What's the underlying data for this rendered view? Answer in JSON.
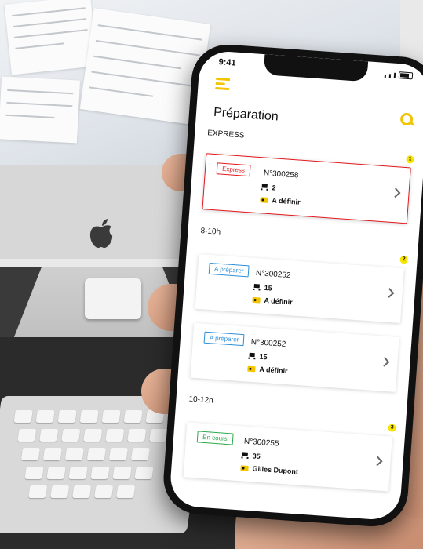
{
  "status_bar": {
    "time": "9:41"
  },
  "header": {
    "title": "Préparation"
  },
  "icons": {
    "menu": "hamburger-menu-icon",
    "search": "search-icon",
    "quantity": "cart-icon",
    "assignee": "id-card-icon",
    "open": "chevron-right-icon"
  },
  "colors": {
    "accent_yellow": "#f2c500",
    "express_red": "#e3191e",
    "prepare_blue": "#2f8fd8",
    "in_progress_green": "#2ea84a"
  },
  "sections": [
    {
      "label": "EXPRESS",
      "count": "1",
      "orders": [
        {
          "status": "Express",
          "number": "N°300258",
          "quantity": "2",
          "assignee": "A définir"
        }
      ]
    },
    {
      "label": "8-10h",
      "count": "2",
      "orders": [
        {
          "status": "A préparer",
          "number": "N°300252",
          "quantity": "15",
          "assignee": "A définir"
        },
        {
          "status": "A préparer",
          "number": "N°300252",
          "quantity": "15",
          "assignee": "A définir"
        }
      ]
    },
    {
      "label": "10-12h",
      "count": "3",
      "orders": [
        {
          "status": "En cours",
          "number": "N°300255",
          "quantity": "35",
          "assignee": "Gilles Dupont"
        }
      ]
    }
  ]
}
